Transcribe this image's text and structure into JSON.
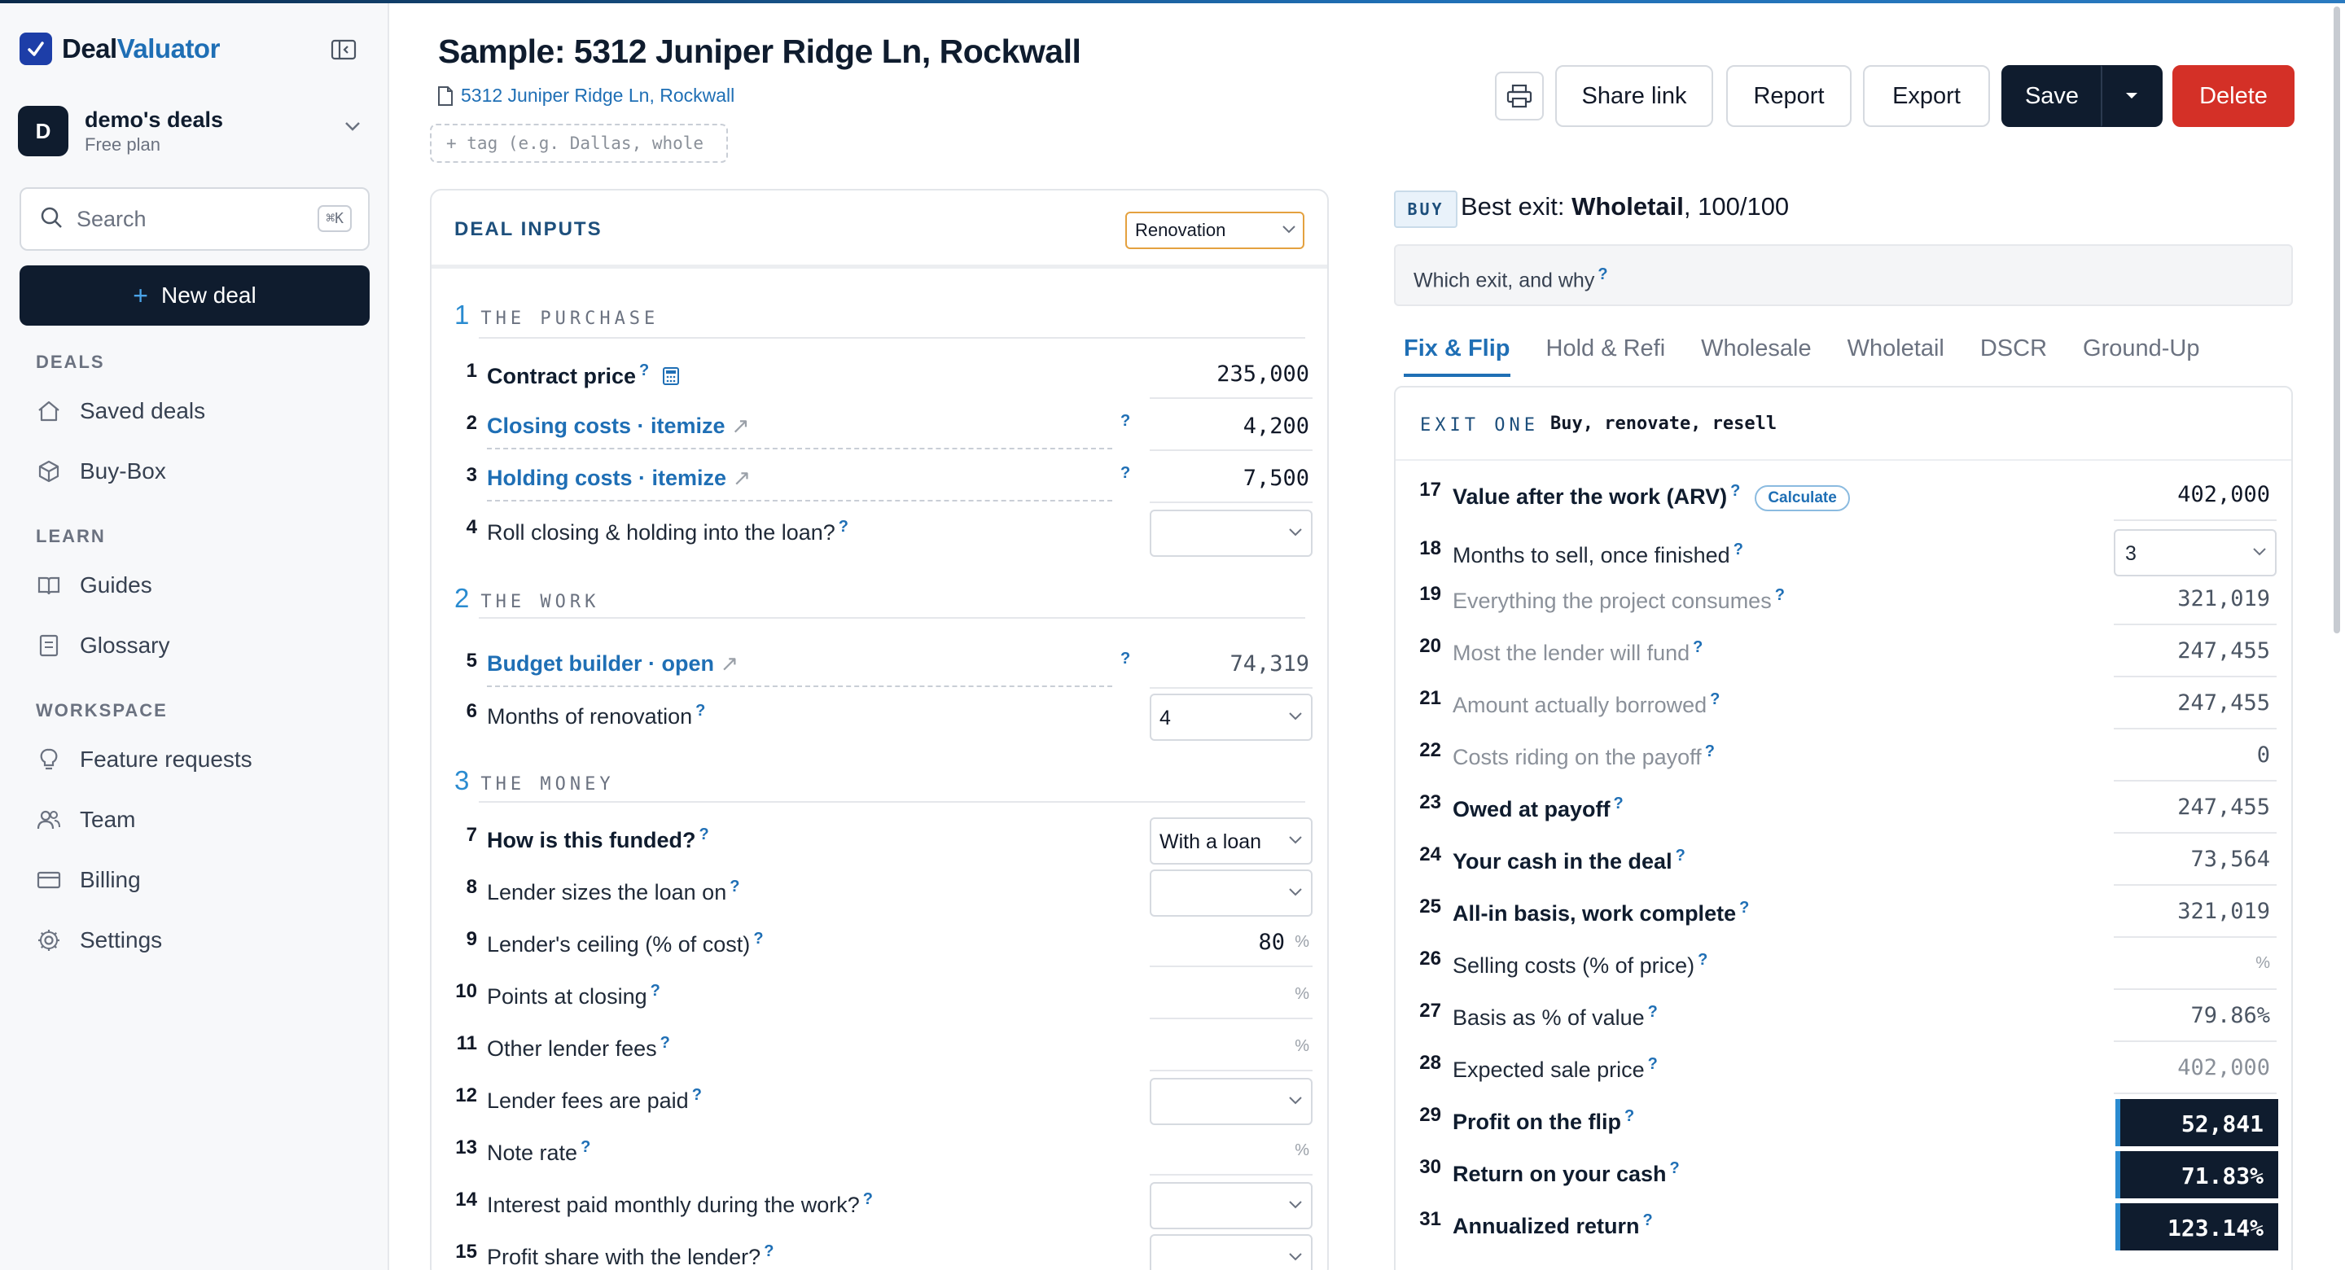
{
  "app": {
    "name_part1": "Deal",
    "name_part2": "Valuator",
    "accent": "#1f6fb5",
    "dark": "#0f1c2e",
    "danger": "#d43027"
  },
  "workspace": {
    "avatar": "D",
    "name": "demo's deals",
    "plan": "Free plan"
  },
  "sidebar": {
    "search_label": "Search",
    "search_shortcut": "⌘K",
    "new_deal_label": "New deal",
    "sections": {
      "deals": "DEALS",
      "learn": "LEARN",
      "workspace": "WORKSPACE"
    },
    "deals_items": [
      {
        "label": "Saved deals",
        "icon": "home-icon"
      },
      {
        "label": "Buy-Box",
        "icon": "box-icon"
      }
    ],
    "learn_items": [
      {
        "label": "Guides",
        "icon": "book-icon"
      },
      {
        "label": "Glossary",
        "icon": "glossary-icon"
      }
    ],
    "workspace_items": [
      {
        "label": "Feature requests",
        "icon": "lightbulb-icon"
      },
      {
        "label": "Team",
        "icon": "users-icon"
      },
      {
        "label": "Billing",
        "icon": "card-icon"
      },
      {
        "label": "Settings",
        "icon": "gear-icon"
      }
    ]
  },
  "header": {
    "title": "Sample: 5312 Juniper Ridge Ln, Rockwall",
    "address_link": "5312 Juniper Ridge Ln, Rockwall",
    "tag_placeholder": "+ tag (e.g. Dallas, whole",
    "buttons": {
      "share": "Share link",
      "report": "Report",
      "export": "Export",
      "save": "Save",
      "delete": "Delete"
    }
  },
  "inputs": {
    "title": "DEAL INPUTS",
    "mode": "Renovation",
    "sections": [
      {
        "num": "1",
        "name": "THE PURCHASE"
      },
      {
        "num": "2",
        "name": "THE WORK"
      },
      {
        "num": "3",
        "name": "THE MONEY"
      }
    ],
    "rows": {
      "r1": {
        "num": "1",
        "label": "Contract price",
        "value": "235,000"
      },
      "r2": {
        "num": "2",
        "label": "Closing costs · itemize",
        "value": "4,200"
      },
      "r3": {
        "num": "3",
        "label": "Holding costs · itemize",
        "value": "7,500"
      },
      "r4": {
        "num": "4",
        "label": "Roll closing & holding into the loan?",
        "value": ""
      },
      "r5": {
        "num": "5",
        "label": "Budget builder · open",
        "value": "74,319"
      },
      "r6": {
        "num": "6",
        "label": "Months of renovation",
        "value": "4"
      },
      "r7": {
        "num": "7",
        "label": "How is this funded?",
        "value": "With a loan"
      },
      "r8": {
        "num": "8",
        "label": "Lender sizes the loan on",
        "value": ""
      },
      "r9": {
        "num": "9",
        "label": "Lender's ceiling (% of cost)",
        "value": "80"
      },
      "r10": {
        "num": "10",
        "label": "Points at closing",
        "value": ""
      },
      "r11": {
        "num": "11",
        "label": "Other lender fees",
        "value": ""
      },
      "r12": {
        "num": "12",
        "label": "Lender fees are paid",
        "value": ""
      },
      "r13": {
        "num": "13",
        "label": "Note rate",
        "value": ""
      },
      "r14": {
        "num": "14",
        "label": "Interest paid monthly during the work?",
        "value": ""
      },
      "r15": {
        "num": "15",
        "label": "Profit share with the lender?",
        "value": ""
      }
    },
    "pct_symbol": "%"
  },
  "best": {
    "badge": "BUY",
    "prefix": "Best exit: ",
    "exit": "Wholetail",
    "score": ", 100/100",
    "why": "Which exit, and why"
  },
  "tabs": [
    "Fix & Flip",
    "Hold & Refi",
    "Wholesale",
    "Wholetail",
    "DSCR",
    "Ground-Up"
  ],
  "exit": {
    "tag": "EXIT ONE",
    "title": "Buy, renovate, resell",
    "calculate": "Calculate",
    "rows": {
      "x17": {
        "num": "17",
        "label": "Value after the work (ARV)",
        "value": "402,000"
      },
      "x18": {
        "num": "18",
        "label": "Months to sell, once finished",
        "value": "3"
      },
      "x19": {
        "num": "19",
        "label": "Everything the project consumes",
        "value": "321,019"
      },
      "x20": {
        "num": "20",
        "label": "Most the lender will fund",
        "value": "247,455"
      },
      "x21": {
        "num": "21",
        "label": "Amount actually borrowed",
        "value": "247,455"
      },
      "x22": {
        "num": "22",
        "label": "Costs riding on the payoff",
        "value": "0"
      },
      "x23": {
        "num": "23",
        "label": "Owed at payoff",
        "value": "247,455"
      },
      "x24": {
        "num": "24",
        "label": "Your cash in the deal",
        "value": "73,564"
      },
      "x25": {
        "num": "25",
        "label": "All-in basis, work complete",
        "value": "321,019"
      },
      "x26": {
        "num": "26",
        "label": "Selling costs (% of price)",
        "value": ""
      },
      "x27": {
        "num": "27",
        "label": "Basis as % of value",
        "value": "79.86%"
      },
      "x28": {
        "num": "28",
        "label": "Expected sale price",
        "value": "402,000"
      },
      "x29": {
        "num": "29",
        "label": "Profit on the flip",
        "value": "52,841"
      },
      "x30": {
        "num": "30",
        "label": "Return on your cash",
        "value": "71.83%"
      },
      "x31": {
        "num": "31",
        "label": "Annualized return",
        "value": "123.14%"
      }
    }
  }
}
